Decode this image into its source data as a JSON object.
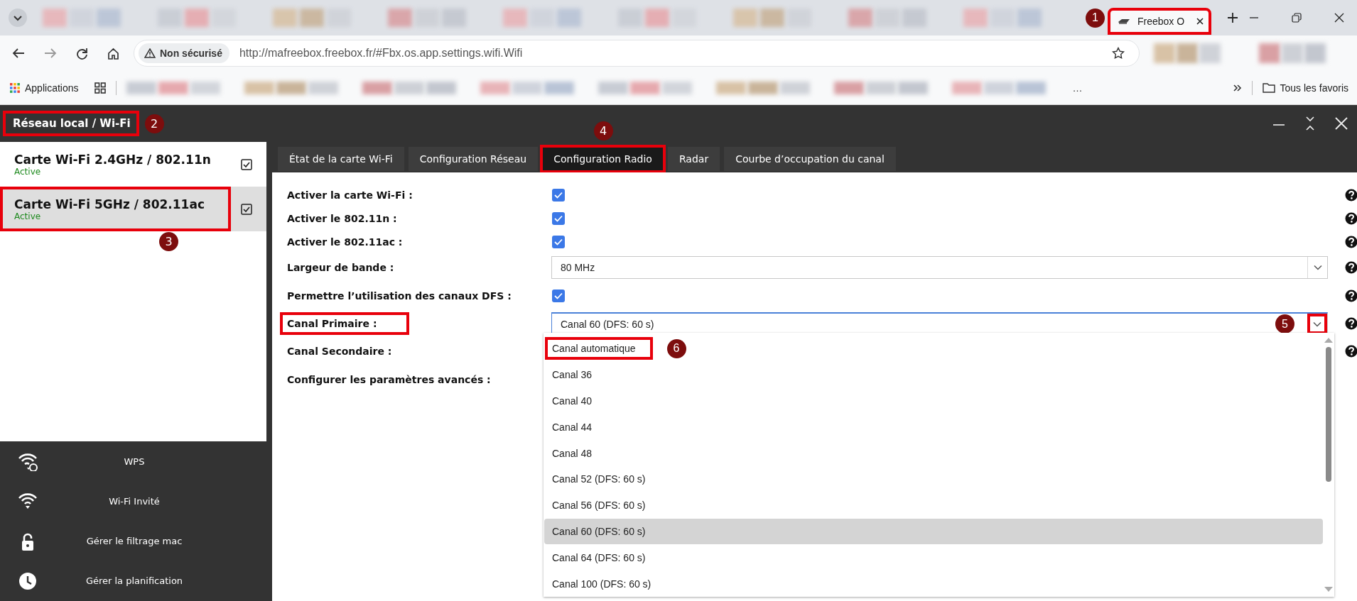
{
  "browser": {
    "tabs": [
      {
        "kind": "blurred"
      },
      {
        "kind": "blurred"
      },
      {
        "kind": "blurred"
      },
      {
        "kind": "blurred"
      },
      {
        "kind": "blurred"
      },
      {
        "kind": "blurred"
      },
      {
        "kind": "blurred"
      },
      {
        "kind": "blurred"
      },
      {
        "kind": "blurred"
      },
      {
        "kind": "page",
        "title": "Freebox O",
        "selected": true,
        "highlighted": true,
        "callout": "1"
      }
    ],
    "address": {
      "security": "Non sécurisé",
      "url": "http://mafreebox.freebox.fr/#Fbx.os.app.settings.wifi.Wifi"
    },
    "bookmarks": [
      {
        "kind": "apps",
        "label": "Applications"
      },
      {
        "kind": "blurred"
      },
      {
        "kind": "blurred"
      },
      {
        "kind": "blurred"
      },
      {
        "kind": "blurred"
      },
      {
        "kind": "blurred"
      },
      {
        "kind": "blurred"
      },
      {
        "kind": "blurred"
      },
      {
        "kind": "blurred"
      },
      {
        "kind": "more",
        "label": "…"
      }
    ],
    "all_bookmarks": "Tous les favoris"
  },
  "app": {
    "title": "Réseau local / Wi-Fi",
    "title_highlighted": true,
    "title_callout": "2",
    "cards": [
      {
        "name": "Carte Wi-Fi 2.4GHz / 802.11n",
        "status": "Active",
        "checked": true,
        "selected": false,
        "highlighted": false
      },
      {
        "name": "Carte Wi-Fi 5GHz / 802.11ac",
        "status": "Active",
        "checked": true,
        "selected": true,
        "highlighted": true,
        "callout": "3"
      }
    ],
    "menu": [
      {
        "label": "WPS"
      },
      {
        "label": "Wi-Fi Invité"
      },
      {
        "label": "Gérer le filtrage mac"
      },
      {
        "label": "Gérer la planification"
      }
    ],
    "tabs": [
      {
        "label": "État de la carte Wi-Fi",
        "selected": false,
        "highlighted": false
      },
      {
        "label": "Configuration Réseau",
        "selected": false,
        "highlighted": false
      },
      {
        "label": "Configuration Radio",
        "selected": true,
        "highlighted": true,
        "callout": "4"
      },
      {
        "label": "Radar",
        "selected": false,
        "highlighted": false
      },
      {
        "label": "Courbe d’occupation du canal",
        "selected": false,
        "highlighted": false
      }
    ],
    "fields": [
      {
        "kind": "checkbox",
        "label": "Activer la carte Wi-Fi :",
        "checked": true,
        "help": true
      },
      {
        "kind": "checkbox",
        "label": "Activer le 802.11n :",
        "checked": true,
        "help": true
      },
      {
        "kind": "checkbox",
        "label": "Activer le 802.11ac :",
        "checked": true,
        "help": true
      },
      {
        "kind": "select",
        "label": "Largeur de bande :",
        "value": "80 MHz",
        "expanded": false,
        "help": true
      },
      {
        "kind": "checkbox",
        "label": "Permettre l’utilisation des canaux DFS :",
        "checked": true,
        "help": true
      },
      {
        "kind": "select",
        "label": "Canal Primaire :",
        "value": "Canal 60 (DFS: 60 s)",
        "expanded": true,
        "label_highlighted": true,
        "arrow_highlighted": true,
        "callout": "5",
        "help": true,
        "options": [
          {
            "label": "Canal automatique",
            "selected": false,
            "highlighted": true,
            "callout": "6"
          },
          {
            "label": "Canal 36",
            "selected": false,
            "highlighted": false
          },
          {
            "label": "Canal 40",
            "selected": false,
            "highlighted": false
          },
          {
            "label": "Canal 44",
            "selected": false,
            "highlighted": false
          },
          {
            "label": "Canal 48",
            "selected": false,
            "highlighted": false
          },
          {
            "label": "Canal 52 (DFS: 60 s)",
            "selected": false,
            "highlighted": false
          },
          {
            "label": "Canal 56 (DFS: 60 s)",
            "selected": false,
            "highlighted": false
          },
          {
            "label": "Canal 60 (DFS: 60 s)",
            "selected": true,
            "highlighted": false
          },
          {
            "label": "Canal 64 (DFS: 60 s)",
            "selected": false,
            "highlighted": false
          },
          {
            "label": "Canal 100 (DFS: 60 s)",
            "selected": false,
            "highlighted": false
          }
        ]
      },
      {
        "kind": "hidden",
        "label": "Canal Secondaire :",
        "help": true
      },
      {
        "kind": "hidden",
        "label": "Configurer les paramètres avancés :",
        "help": false
      }
    ]
  }
}
